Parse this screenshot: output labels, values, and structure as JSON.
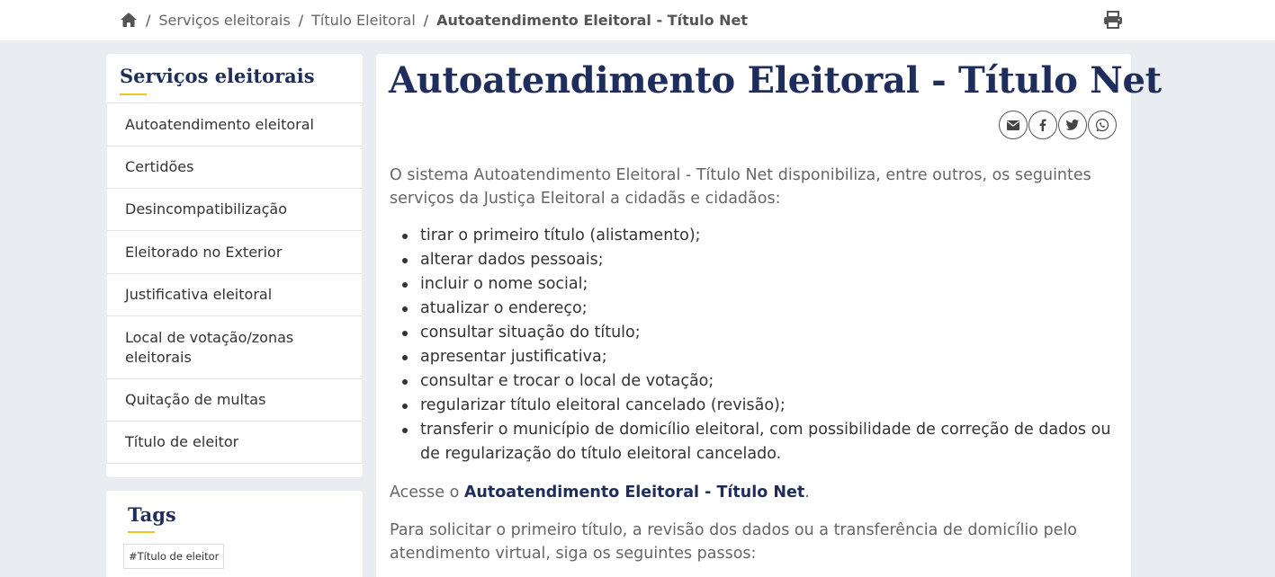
{
  "breadcrumb": {
    "home_icon": "home-icon",
    "sep1": "/",
    "sep2": "/",
    "sep3": "/",
    "item1": "Serviços eleitorais",
    "item2": "Título Eleitoral",
    "current": "Autoatendimento Eleitoral - Título Net"
  },
  "toolbar": {
    "print_icon": "print-icon"
  },
  "sidebar": {
    "title": "Serviços eleitorais",
    "items": [
      {
        "label": "Autoatendimento eleitoral"
      },
      {
        "label": "Certidões"
      },
      {
        "label": "Desincompatibilização"
      },
      {
        "label": "Eleitorado no Exterior"
      },
      {
        "label": "Justificativa eleitoral"
      },
      {
        "label": "Local de votação/zonas eleitorais"
      },
      {
        "label": "Quitação de multas"
      },
      {
        "label": "Título de eleitor"
      }
    ]
  },
  "tags": {
    "title": "Tags",
    "items": [
      {
        "label": "#Título de eleitor"
      }
    ]
  },
  "main": {
    "title": "Autoatendimento Eleitoral - Título Net",
    "share_icons": [
      "envelope-icon",
      "facebook-icon",
      "twitter-icon",
      "whatsapp-icon"
    ],
    "intro": "O sistema Autoatendimento Eleitoral - Título Net disponibiliza, entre outros, os seguintes serviços da Justiça Eleitoral a cidadãs e cidadãos:",
    "services": [
      "tirar o primeiro título (alistamento);",
      "alterar dados pessoais;",
      "incluir o nome social;",
      "atualizar o endereço;",
      "consultar situação do título;",
      "apresentar justificativa;",
      "consultar e trocar o local de votação;",
      "regularizar título eleitoral cancelado (revisão);",
      "transferir o município de domicílio eleitoral, com possibilidade de correção de dados ou de regularização do título eleitoral cancelado."
    ],
    "access_prefix": "Acesse o ",
    "access_link": "Autoatendimento Eleitoral - Título Net",
    "access_suffix": ".",
    "steps_intro": "Para solicitar o primeiro título, a revisão dos dados ou a transferência de domicílio pelo atendimento virtual, siga os seguintes passos:"
  },
  "colors": {
    "navy": "#1f2d5c",
    "accent_yellow": "#f0c420",
    "page_bg": "#e9ecf1"
  }
}
